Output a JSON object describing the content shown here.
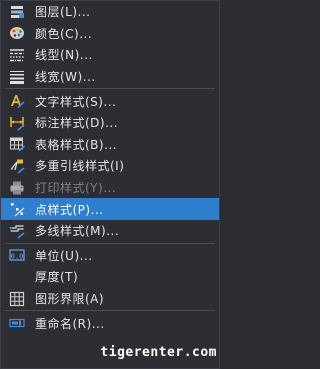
{
  "menu": {
    "groups": [
      [
        {
          "label": "图层(L)...",
          "icon": "layers-icon"
        },
        {
          "label": "颜色(C)...",
          "icon": "color-palette-icon"
        },
        {
          "label": "线型(N)...",
          "icon": "linetype-icon"
        },
        {
          "label": "线宽(W)...",
          "icon": "lineweight-icon"
        }
      ],
      [
        {
          "label": "文字样式(S)...",
          "icon": "text-style-icon"
        },
        {
          "label": "标注样式(D)...",
          "icon": "dimension-style-icon"
        },
        {
          "label": "表格样式(B)...",
          "icon": "table-style-icon"
        },
        {
          "label": "多重引线样式(I)",
          "icon": "multileader-style-icon"
        },
        {
          "label": "打印样式(Y)...",
          "icon": "plot-style-icon",
          "disabled": true
        },
        {
          "label": "点样式(P)...",
          "icon": "point-style-icon",
          "highlight": true
        },
        {
          "label": "多线样式(M)...",
          "icon": "multiline-style-icon"
        }
      ],
      [
        {
          "label": "单位(U)...",
          "icon": "units-icon"
        },
        {
          "label": "厚度(T)",
          "icon": "thickness-icon"
        },
        {
          "label": "图形界限(A)",
          "icon": "drawing-limits-icon"
        }
      ],
      [
        {
          "label": "重命名(R)...",
          "icon": "rename-icon"
        }
      ]
    ]
  },
  "watermark": "tigerenter.com",
  "colors": {
    "background": "#2c2e33",
    "highlight": "#2f7fd1",
    "text": "#e6e6e6",
    "disabled_text": "#7d8088",
    "separator": "#4a4d54"
  }
}
